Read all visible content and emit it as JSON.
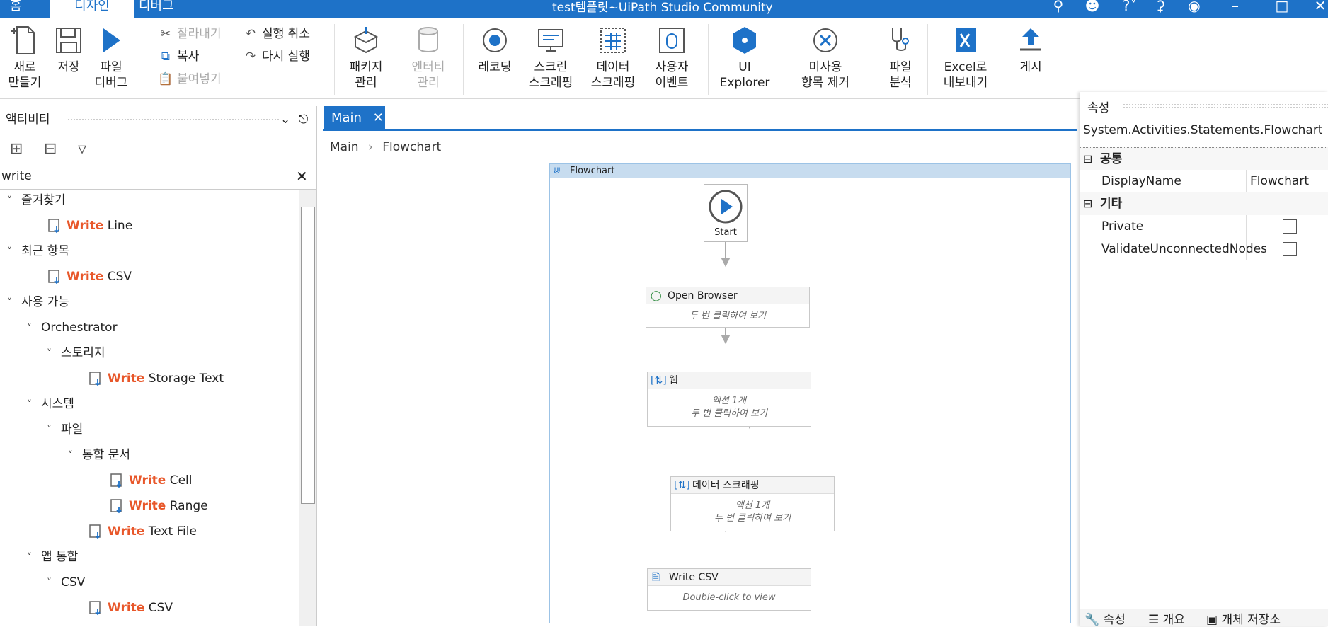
{
  "titlebar": {
    "tabs": [
      "홈",
      "디자인",
      "디버그"
    ],
    "app_title": "test템플릿~UiPath Studio Community",
    "accent": "#1e72c8"
  },
  "ribbon": {
    "new": "새로\n만들기",
    "save": "저장",
    "debug_file": "파일\n디버그",
    "cut": "잘라내기",
    "copy": "복사",
    "paste": "붙여넣기",
    "undo": "실행 취소",
    "redo": "다시 실행",
    "manage_packages": "패키지\n관리",
    "manage_entities": "엔터티\n관리",
    "recording": "레코딩",
    "screen_scraping": "스크린\n스크래핑",
    "data_scraping": "데이터\n스크래핑",
    "user_events": "사용자\n이벤트",
    "ui_explorer": "UI\nExplorer",
    "remove_unused": "미사용\n항목 제거",
    "analyze_file": "파일\n분석",
    "export_excel": "Excel로\n내보내기",
    "publish": "게시"
  },
  "activities": {
    "title": "액티비티",
    "search_value": "write",
    "tree": [
      {
        "label": "즐겨찾기",
        "level": 0
      },
      {
        "prefix": "Write",
        "label": " Line",
        "level": 2,
        "icon": "write-line-icon"
      },
      {
        "label": "최근 항목",
        "level": 0
      },
      {
        "prefix": "Write",
        "label": " CSV",
        "level": 2,
        "icon": "write-csv-icon"
      },
      {
        "label": "사용 가능",
        "level": 0
      },
      {
        "label": "Orchestrator",
        "level": 1
      },
      {
        "label": "스토리지",
        "level": 2
      },
      {
        "prefix": "Write",
        "label": " Storage Text",
        "level": 4,
        "icon": "write-storage-text-icon"
      },
      {
        "label": "시스템",
        "level": 1
      },
      {
        "label": "파일",
        "level": 2
      },
      {
        "label": "통합 문서",
        "level": 3
      },
      {
        "prefix": "Write",
        "label": " Cell",
        "level": 5,
        "icon": "write-cell-icon"
      },
      {
        "prefix": "Write",
        "label": " Range",
        "level": 5,
        "icon": "write-range-icon"
      },
      {
        "prefix": "Write",
        "label": " Text File",
        "level": 4,
        "icon": "write-text-file-icon"
      },
      {
        "label": "앱 통합",
        "level": 1
      },
      {
        "label": "CSV",
        "level": 2
      },
      {
        "prefix": "Write",
        "label": " CSV",
        "level": 4,
        "icon": "write-csv-icon"
      }
    ]
  },
  "designer": {
    "tab": "Main",
    "breadcrumb": [
      "Main",
      "Flowchart"
    ],
    "flowchart_label": "Flowchart",
    "start": "Start",
    "nodes": [
      {
        "title": "Open Browser",
        "line1": "두 번 클릭하여 보기",
        "line2": ""
      },
      {
        "title": "웹",
        "line1": "액션 1개",
        "line2": "두 번 클릭하여 보기"
      },
      {
        "title": "데이터 스크래핑",
        "line1": "액션 1개",
        "line2": "두 번 클릭하여 보기"
      },
      {
        "title": "Write CSV",
        "line1": "Double-click to view",
        "line2": ""
      }
    ]
  },
  "properties": {
    "title": "속성",
    "type_name": "System.Activities.Statements.Flowchart",
    "cat_common": "공통",
    "display_name_label": "DisplayName",
    "display_name_value": "Flowchart",
    "cat_misc": "기타",
    "private_label": "Private",
    "validate_label": "ValidateUnconnectedNodes",
    "private_checked": false,
    "validate_checked": false,
    "bottom_tabs": [
      "속성",
      "개요",
      "개체 저장소"
    ]
  }
}
